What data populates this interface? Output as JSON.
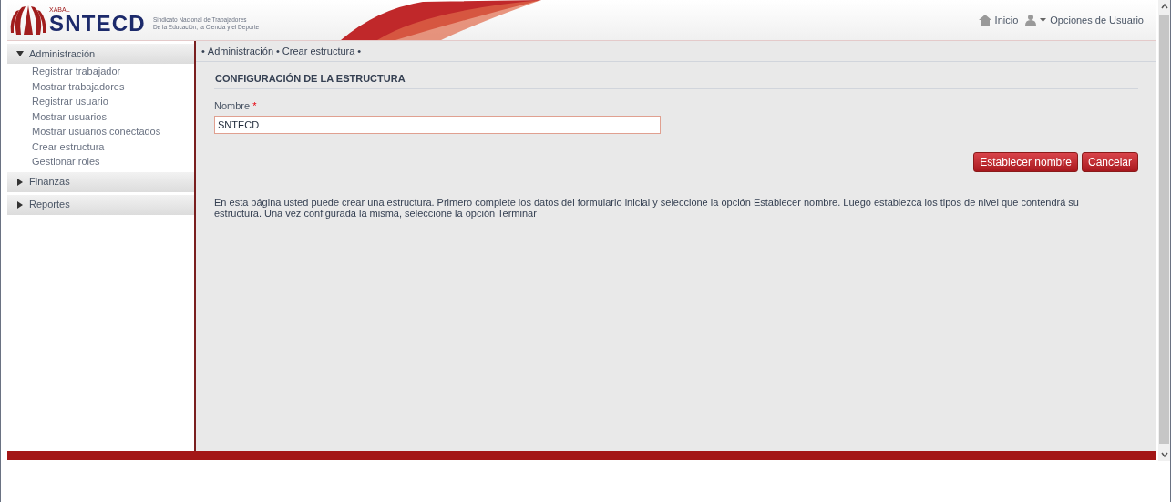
{
  "header": {
    "logo_small": "XABAL",
    "logo": "SNTECD",
    "tagline_1": "Sindicato Nacional de Trabajadores",
    "tagline_2": "De la Educación, la Ciencia y el Deporte",
    "links": [
      {
        "kind": "home",
        "label": "Inicio"
      },
      {
        "kind": "user",
        "label": "Opciones de Usuario"
      }
    ]
  },
  "sidebar": {
    "groups": [
      {
        "label": "Administración",
        "expanded": true,
        "items": [
          "Registrar trabajador",
          "Mostrar trabajadores",
          "Registrar usuario",
          "Mostrar usuarios",
          "Mostrar usuarios conectados",
          "Crear estructura",
          "Gestionar roles"
        ]
      },
      {
        "label": "Finanzas",
        "expanded": false
      },
      {
        "label": "Reportes",
        "expanded": false
      }
    ]
  },
  "breadcrumb": {
    "separator": "•",
    "items": [
      "Administración",
      "Crear estructura"
    ]
  },
  "form": {
    "title": "CONFIGURACIÓN DE LA ESTRUCTURA",
    "field_label": "Nombre",
    "required_mark": "*",
    "value": "SNTECD",
    "buttons": [
      "Establecer nombre",
      "Cancelar"
    ]
  },
  "help_text": "En esta página usted puede crear una estructura. Primero complete los datos del formulario inicial y seleccione la opción Establecer nombre. Luego establezca los tipos de nivel que contendrá su estructura. Una vez configurada la misma, seleccione la opción Terminar"
}
